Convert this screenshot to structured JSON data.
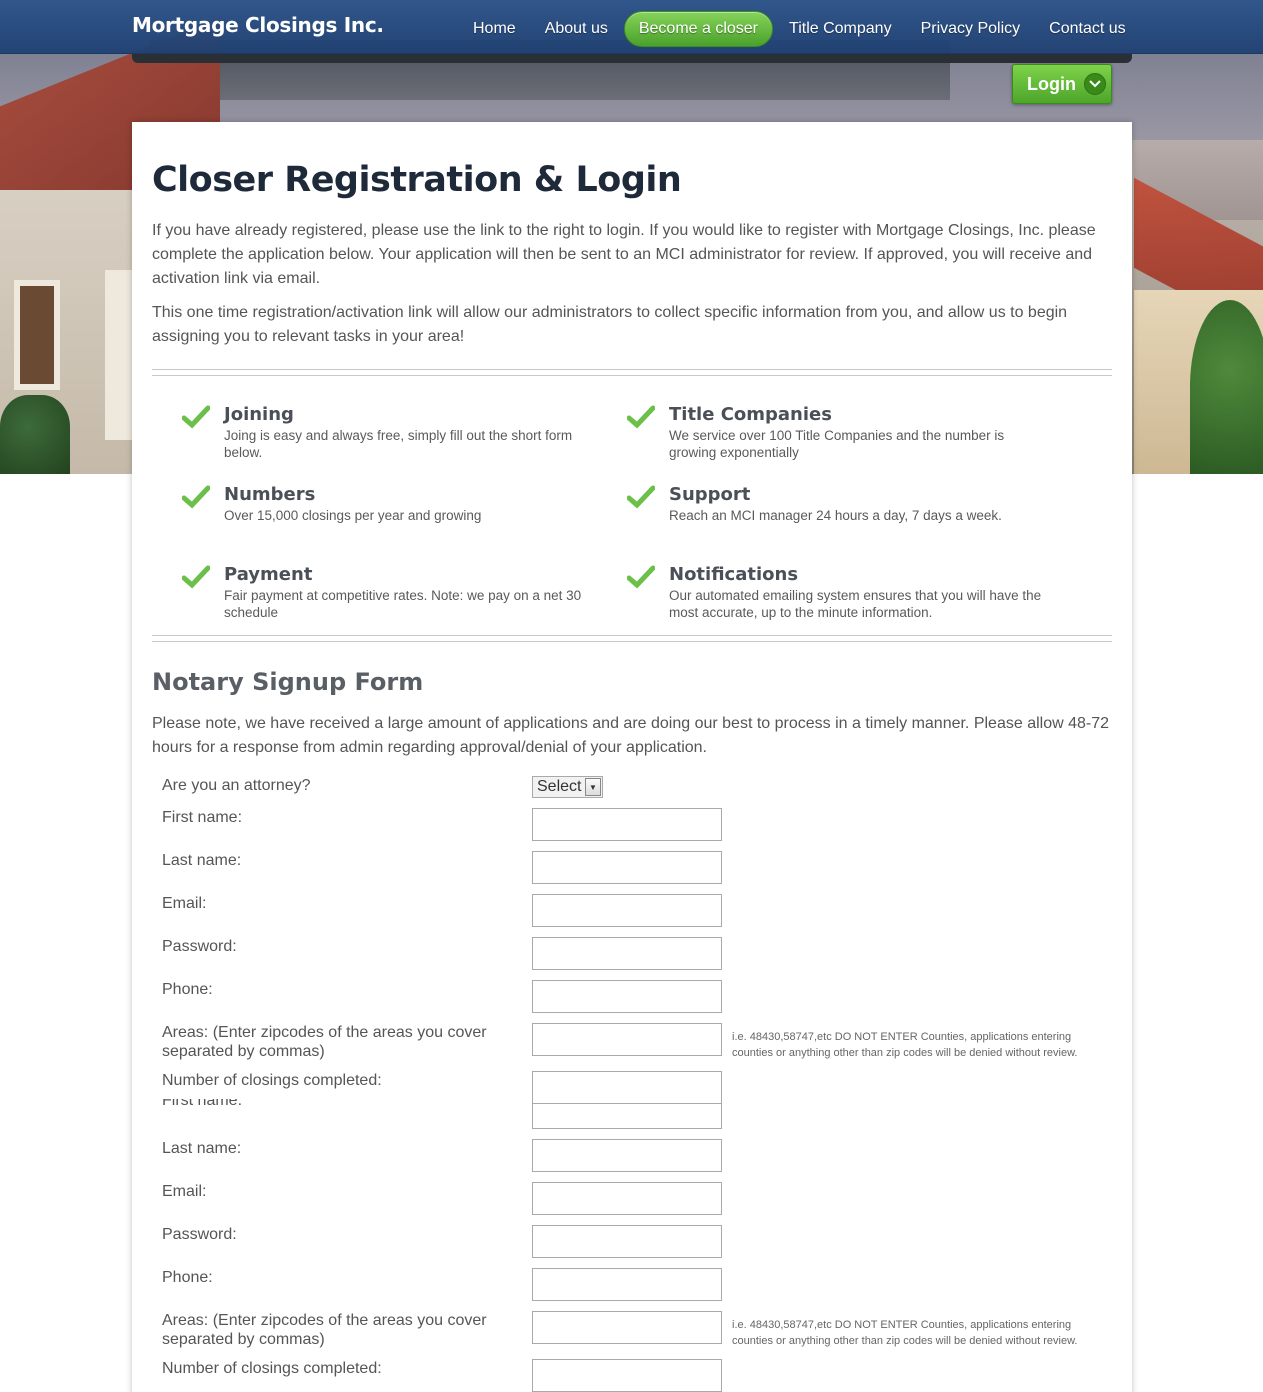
{
  "brand": "Mortgage Closings Inc.",
  "nav": [
    {
      "label": "Home",
      "active": false
    },
    {
      "label": "About us",
      "active": false
    },
    {
      "label": "Become a closer",
      "active": true
    },
    {
      "label": "Title Company",
      "active": false
    },
    {
      "label": "Privacy Policy",
      "active": false
    },
    {
      "label": "Contact us",
      "active": false
    }
  ],
  "login": {
    "label": "Login"
  },
  "page": {
    "title": "Closer Registration & Login",
    "intro_p1": "If you have already registered, please use the link to the right to login. If you would like to register with Mortgage Closings, Inc. please complete the application below. Your application will then be sent to an MCI administrator for review. If approved, you will receive and activation link via email.",
    "intro_p2": "This one time registration/activation link will allow our administrators to collect specific information from you, and allow us to begin assigning you to relevant tasks in your area!"
  },
  "features": [
    {
      "title": "Joining",
      "desc": "Joing is easy and always free, simply fill out the short form below."
    },
    {
      "title": "Title Companies",
      "desc": "We service over 100 Title Companies and the number is growing exponentially"
    },
    {
      "title": "Numbers",
      "desc": "Over 15,000 closings per year and growing"
    },
    {
      "title": "Support",
      "desc": "Reach an MCI manager 24 hours a day, 7 days a week."
    },
    {
      "title": "Payment",
      "desc": "Fair payment at competitive rates. Note: we pay on a net 30 schedule"
    },
    {
      "title": "Notifications",
      "desc": "Our automated emailing system ensures that you will have the most accurate, up to the minute information."
    }
  ],
  "form": {
    "title": "Notary Signup Form",
    "notice": "Please note, we have received a large amount of applications and are doing our best to process in a timely manner. Please allow 48-72 hours for a response from admin regarding approval/denial of your application.",
    "attorney_label": "Are you an attorney?",
    "attorney_value": "Select",
    "labels": {
      "first_name": "First name:",
      "last_name": "Last name:",
      "email": "Email:",
      "password": "Password:",
      "phone": "Phone:",
      "areas": "Areas: (Enter zipcodes of the areas you cover separated by commas)",
      "closings": "Number of closings completed:"
    },
    "areas_hint": "i.e. 48430,58747,etc DO NOT ENTER Counties, applications entering counties or anything other than zip codes will be denied without review."
  }
}
